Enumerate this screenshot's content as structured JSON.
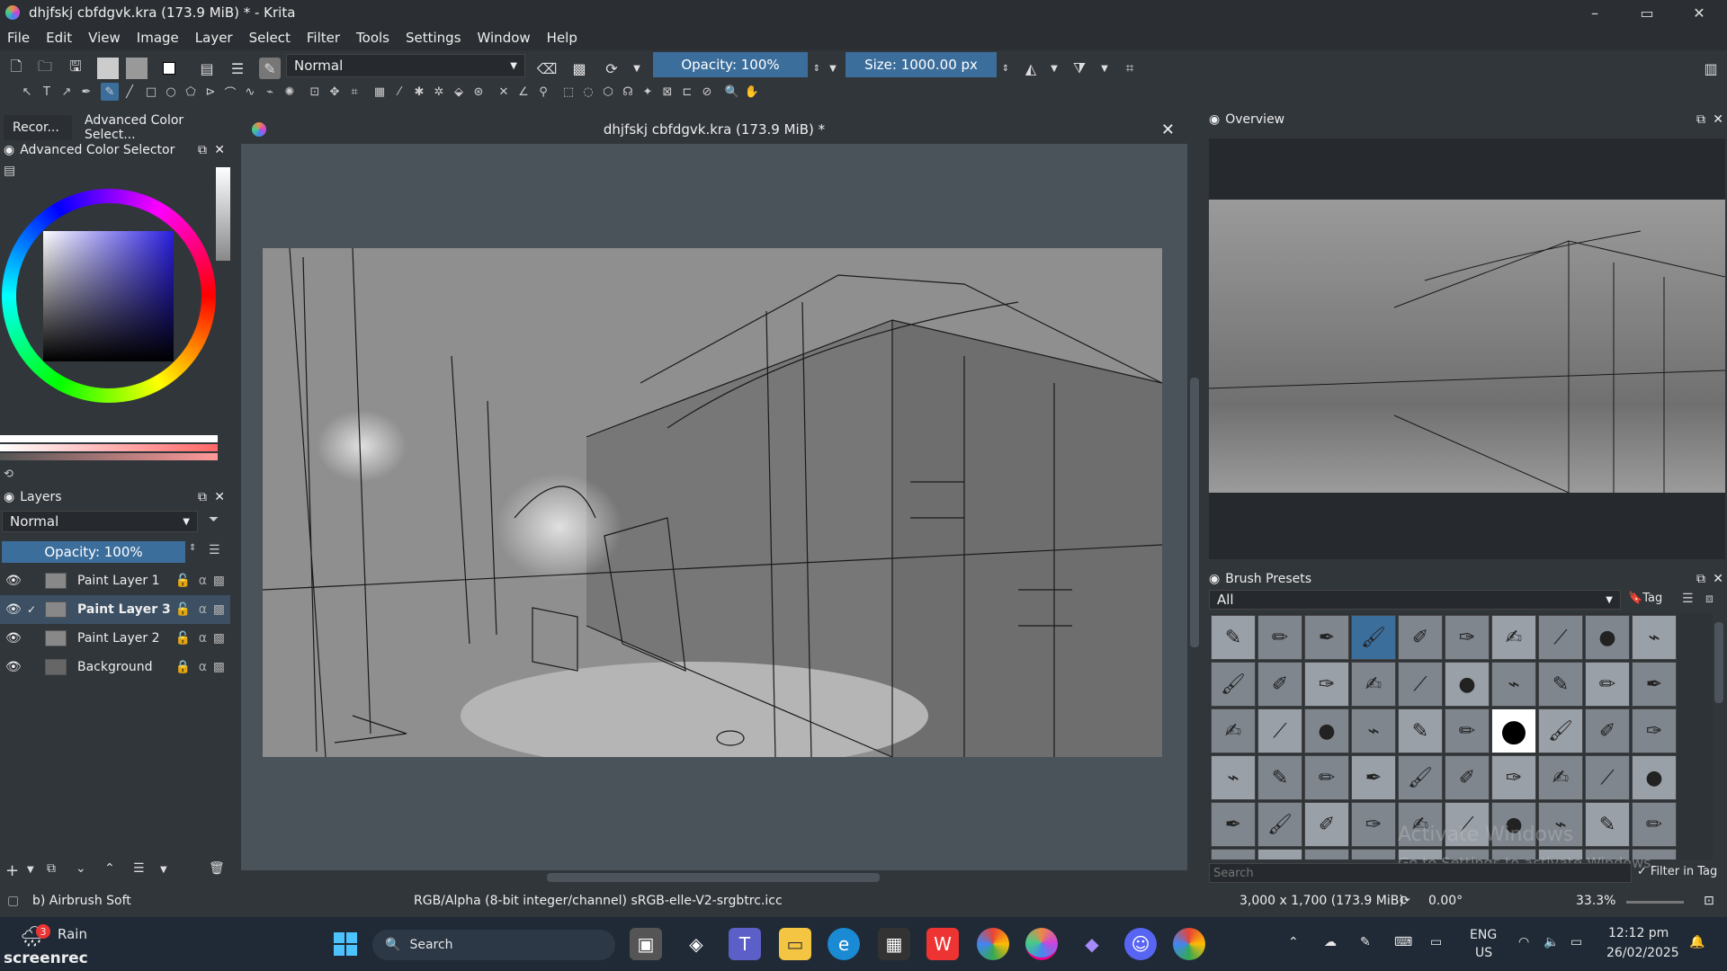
{
  "window": {
    "title": "dhjfskj cbfdgvk.kra (173.9 MiB) * - Krita",
    "minimize": "–",
    "maximize": "▭",
    "close": "✕"
  },
  "menu": [
    "File",
    "Edit",
    "View",
    "Image",
    "Layer",
    "Select",
    "Filter",
    "Tools",
    "Settings",
    "Window",
    "Help"
  ],
  "toolbar": {
    "blend_mode": "Normal",
    "opacity": "Opacity: 100%",
    "size": "Size: 1000.00 px"
  },
  "left_tabs": {
    "tab1": "Recor...",
    "tab2": "Advanced Color Select..."
  },
  "color_selector": {
    "title": "Advanced Color Selector"
  },
  "layers": {
    "title": "Layers",
    "blend": "Normal",
    "opacity": "Opacity:  100%",
    "items": [
      {
        "name": "Paint Layer 1",
        "selected": false
      },
      {
        "name": "Paint Layer 3",
        "selected": true
      },
      {
        "name": "Paint Layer 2",
        "selected": false
      },
      {
        "name": "Background",
        "selected": false
      }
    ]
  },
  "document": {
    "title": "dhjfskj cbfdgvk.kra (173.9 MiB) *",
    "close": "✕"
  },
  "overview": {
    "title": "Overview"
  },
  "brush_presets": {
    "title": "Brush Presets",
    "filter": "All",
    "tag": "Tag",
    "search_placeholder": "Search",
    "filter_in_tag": "Filter in Tag",
    "watermark_line1": "Activate Windows",
    "watermark_line2": "Go to Settings to activate Windows."
  },
  "status": {
    "brush": "b) Airbrush Soft",
    "color_space": "RGB/Alpha (8-bit integer/channel)  sRGB-elle-V2-srgbtrc.icc",
    "dimensions": "3,000 x 1,700 (173.9 MiB)",
    "rotation": "0.00°",
    "zoom": "33.3%"
  },
  "taskbar": {
    "weather_badge": "3",
    "weather": "Rain",
    "search": "Search",
    "lang1": "ENG",
    "lang2": "US",
    "time": "12:12 pm",
    "date": "26/02/2025",
    "screenrec": "screenrec"
  }
}
